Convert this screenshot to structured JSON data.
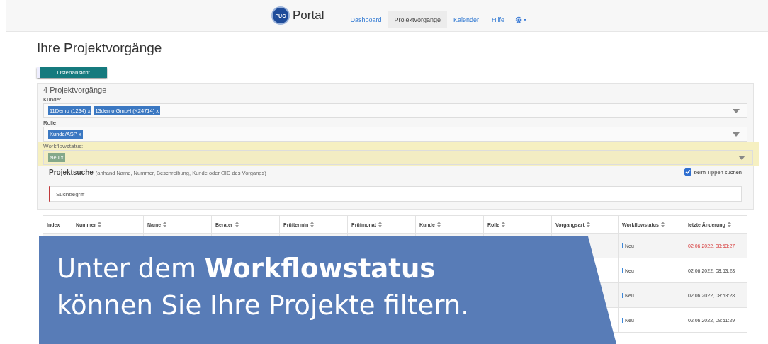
{
  "nav": {
    "logo_text": "PÜG",
    "brand": "Portal",
    "items": [
      {
        "label": "Dashboard",
        "selected": false
      },
      {
        "label": "Projektvorgänge",
        "selected": true
      },
      {
        "label": "Kalender",
        "selected": false
      },
      {
        "label": "Hilfe",
        "selected": false
      }
    ]
  },
  "page_title": "Ihre Projektvorgänge",
  "view_button": "Listenansicht",
  "count": "4 Projektvorgänge",
  "filters": [
    {
      "label": "Kunde:",
      "highlighted": false,
      "tags": [
        {
          "label": "11Demo (1234)",
          "remove": "x",
          "color": "#3b78c2"
        },
        {
          "label": "13demo GmbH (K24714)",
          "remove": "x",
          "color": "#3b78c2"
        }
      ]
    },
    {
      "label": "Rolle:",
      "highlighted": false,
      "tags": [
        {
          "label": "Kunde/ASP",
          "remove": "x",
          "color": "#3b78c2"
        }
      ]
    },
    {
      "label": "Workflowstatus:",
      "highlighted": true,
      "tags": [
        {
          "label": "Neu",
          "remove": "x",
          "color": "#84a88a"
        }
      ]
    }
  ],
  "search": {
    "title": "Projektsuche",
    "hint": "(anhand Name, Nummer, Beschreibung, Kunde oder OID des Vorgangs)",
    "placeholder": "Suchbegriff",
    "live_label": "beim Tippen suchen",
    "live_checked": true
  },
  "table": {
    "columns": [
      {
        "label": "Index",
        "sortable": false
      },
      {
        "label": "Nummer",
        "sortable": true
      },
      {
        "label": "Name",
        "sortable": true
      },
      {
        "label": "Berater",
        "sortable": true
      },
      {
        "label": "Prüftermin",
        "sortable": true
      },
      {
        "label": "Prüfmonat",
        "sortable": true
      },
      {
        "label": "Kunde",
        "sortable": true
      },
      {
        "label": "Rolle",
        "sortable": true
      },
      {
        "label": "Vorgangsart",
        "sortable": true
      },
      {
        "label": "Workflowstatus",
        "sortable": true
      },
      {
        "label": "letzte Änderung",
        "sortable": true
      }
    ],
    "rows": [
      {
        "overdue": true,
        "cells": [
          null,
          null,
          null,
          null,
          null,
          null,
          null,
          null,
          null,
          "Neu",
          "02.06.2022, 08:53:27"
        ]
      },
      {
        "overdue": false,
        "cells": [
          null,
          null,
          null,
          null,
          null,
          null,
          null,
          null,
          null,
          "Neu",
          "02.06.2022, 08:53:28"
        ]
      },
      {
        "overdue": false,
        "cells": [
          null,
          null,
          null,
          null,
          null,
          null,
          null,
          null,
          null,
          "Neu",
          "02.06.2022, 08:53:28"
        ]
      },
      {
        "overdue": false,
        "cells": [
          null,
          null,
          null,
          null,
          null,
          null,
          null,
          null,
          null,
          "Neu",
          "02.06.2022, 09:51:29"
        ]
      }
    ]
  },
  "caption": "Unter dem **Workflowstatus** können Sie Ihre Projekte filtern."
}
